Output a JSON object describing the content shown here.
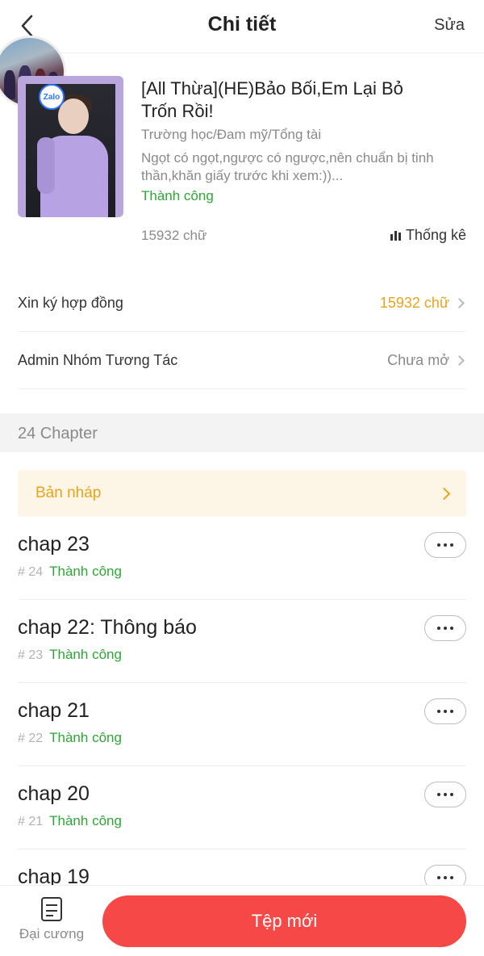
{
  "header": {
    "title": "Chi tiết",
    "edit_label": "Sửa"
  },
  "book": {
    "title": "[All Thừa](HE)Bảo Bối,Em Lại Bỏ Trốn Rồi!",
    "tags": "Trường học/Đam mỹ/Tổng tài",
    "description": "Ngọt có ngọt,ngược có ngược,nên chuẩn bị tinh thần,khăn giấy  trước khi xem:))...",
    "status": "Thành công",
    "word_count": "15932 chữ",
    "stats_label": "Thống kê",
    "cover_badge": "Zalo"
  },
  "rows": [
    {
      "label": "Xin ký hợp đồng",
      "value": "15932 chữ"
    },
    {
      "label": "Admin Nhóm Tương Tác",
      "value": "Chưa mở"
    }
  ],
  "chapters_section": {
    "heading": "24 Chapter",
    "draft_label": "Bản nháp"
  },
  "chapters": [
    {
      "title": "chap 23",
      "number": "# 24",
      "status": "Thành công"
    },
    {
      "title": "chap 22: Thông báo",
      "number": "# 23",
      "status": "Thành công"
    },
    {
      "title": "chap 21",
      "number": "# 22",
      "status": "Thành công"
    },
    {
      "title": "chap 20",
      "number": "# 21",
      "status": "Thành công"
    },
    {
      "title": "chap 19",
      "number": "",
      "status": ""
    }
  ],
  "bottom_bar": {
    "outline_label": "Đại cương",
    "new_file_label": "Tệp mới"
  },
  "colors": {
    "accent_red": "#f74848",
    "success_green": "#2aa834",
    "warning_orange": "#e8a41c",
    "muted_gray": "#8a8a8a"
  }
}
